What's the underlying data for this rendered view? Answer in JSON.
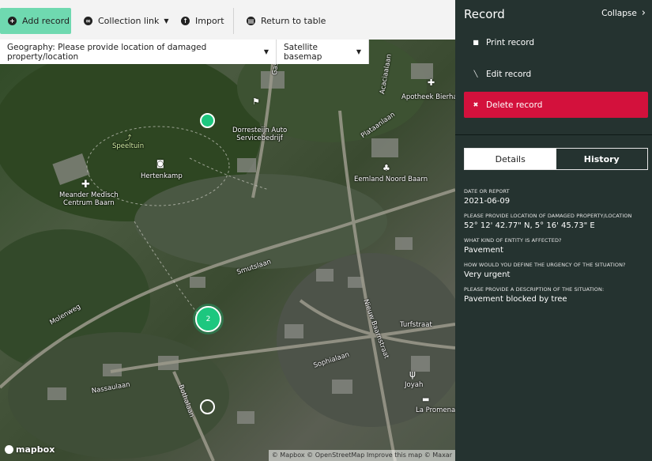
{
  "toolbar": {
    "add_record": "Add record",
    "collection_link": "Collection link",
    "import": "Import",
    "return_to_table": "Return to table",
    "accent_color": "#6fd9b0"
  },
  "map": {
    "geography_filter": "Geography: Please provide location of damaged property/location",
    "basemap_filter": "Satellite basemap",
    "labels": {
      "speeltuin": "Speeltuin",
      "meander": "Meander Medisch\nCentrum Baarn",
      "hertenkamp": "Hertenkamp",
      "dorrestein": "Dorresteijn Auto\nServicebedrijf",
      "apotheek": "Apotheek Bierhaa...",
      "eemland": "Eemland Noord Baarn",
      "joyah": "Joyah",
      "la_promenade": "La Promenad...",
      "gasstaan": "Gasstaan",
      "acaciaalaan": "Acaciaalaan",
      "plataanlaan": "Plataanlaan",
      "smutslaan": "Smutslaan",
      "molenweg": "Molenweg",
      "nieuw_baarnstraat": "Nieuw Baarnstraat",
      "turfstraat": "Turfstraat",
      "sophialaan": "Sophialaan",
      "nassaulaan": "Nassaulaan",
      "bothalaan": "Bothalaan"
    },
    "cluster_count": "2",
    "marker_color": "#1dc77f",
    "logo": "mapbox",
    "attribution": "© Mapbox © OpenStreetMap Improve this map © Maxar"
  },
  "panel": {
    "title": "Record",
    "collapse": "Collapse",
    "actions": {
      "print": "Print record",
      "edit": "Edit record",
      "delete": "Delete record",
      "delete_color": "#d3113c"
    },
    "tabs": [
      "Details",
      "History"
    ],
    "fields": [
      {
        "label": "DATE OR REPORT",
        "value": "2021-06-09"
      },
      {
        "label": "PLEASE PROVIDE LOCATION OF DAMAGED PROPERTY/LOCATION",
        "value": "52° 12' 42.77\" N, 5° 16' 45.73\" E"
      },
      {
        "label": "WHAT KIND OF ENTITY IS AFFECTED?",
        "value": "Pavement"
      },
      {
        "label": "HOW WOULD YOU DEFINE THE URGENCY OF THE SITUATION?",
        "value": "Very urgent"
      },
      {
        "label": "PLEASE PROVIDE A DESCRIPTION OF THE SITUATION:",
        "value": "Pavement blocked by tree"
      }
    ],
    "background_color": "#253330"
  }
}
